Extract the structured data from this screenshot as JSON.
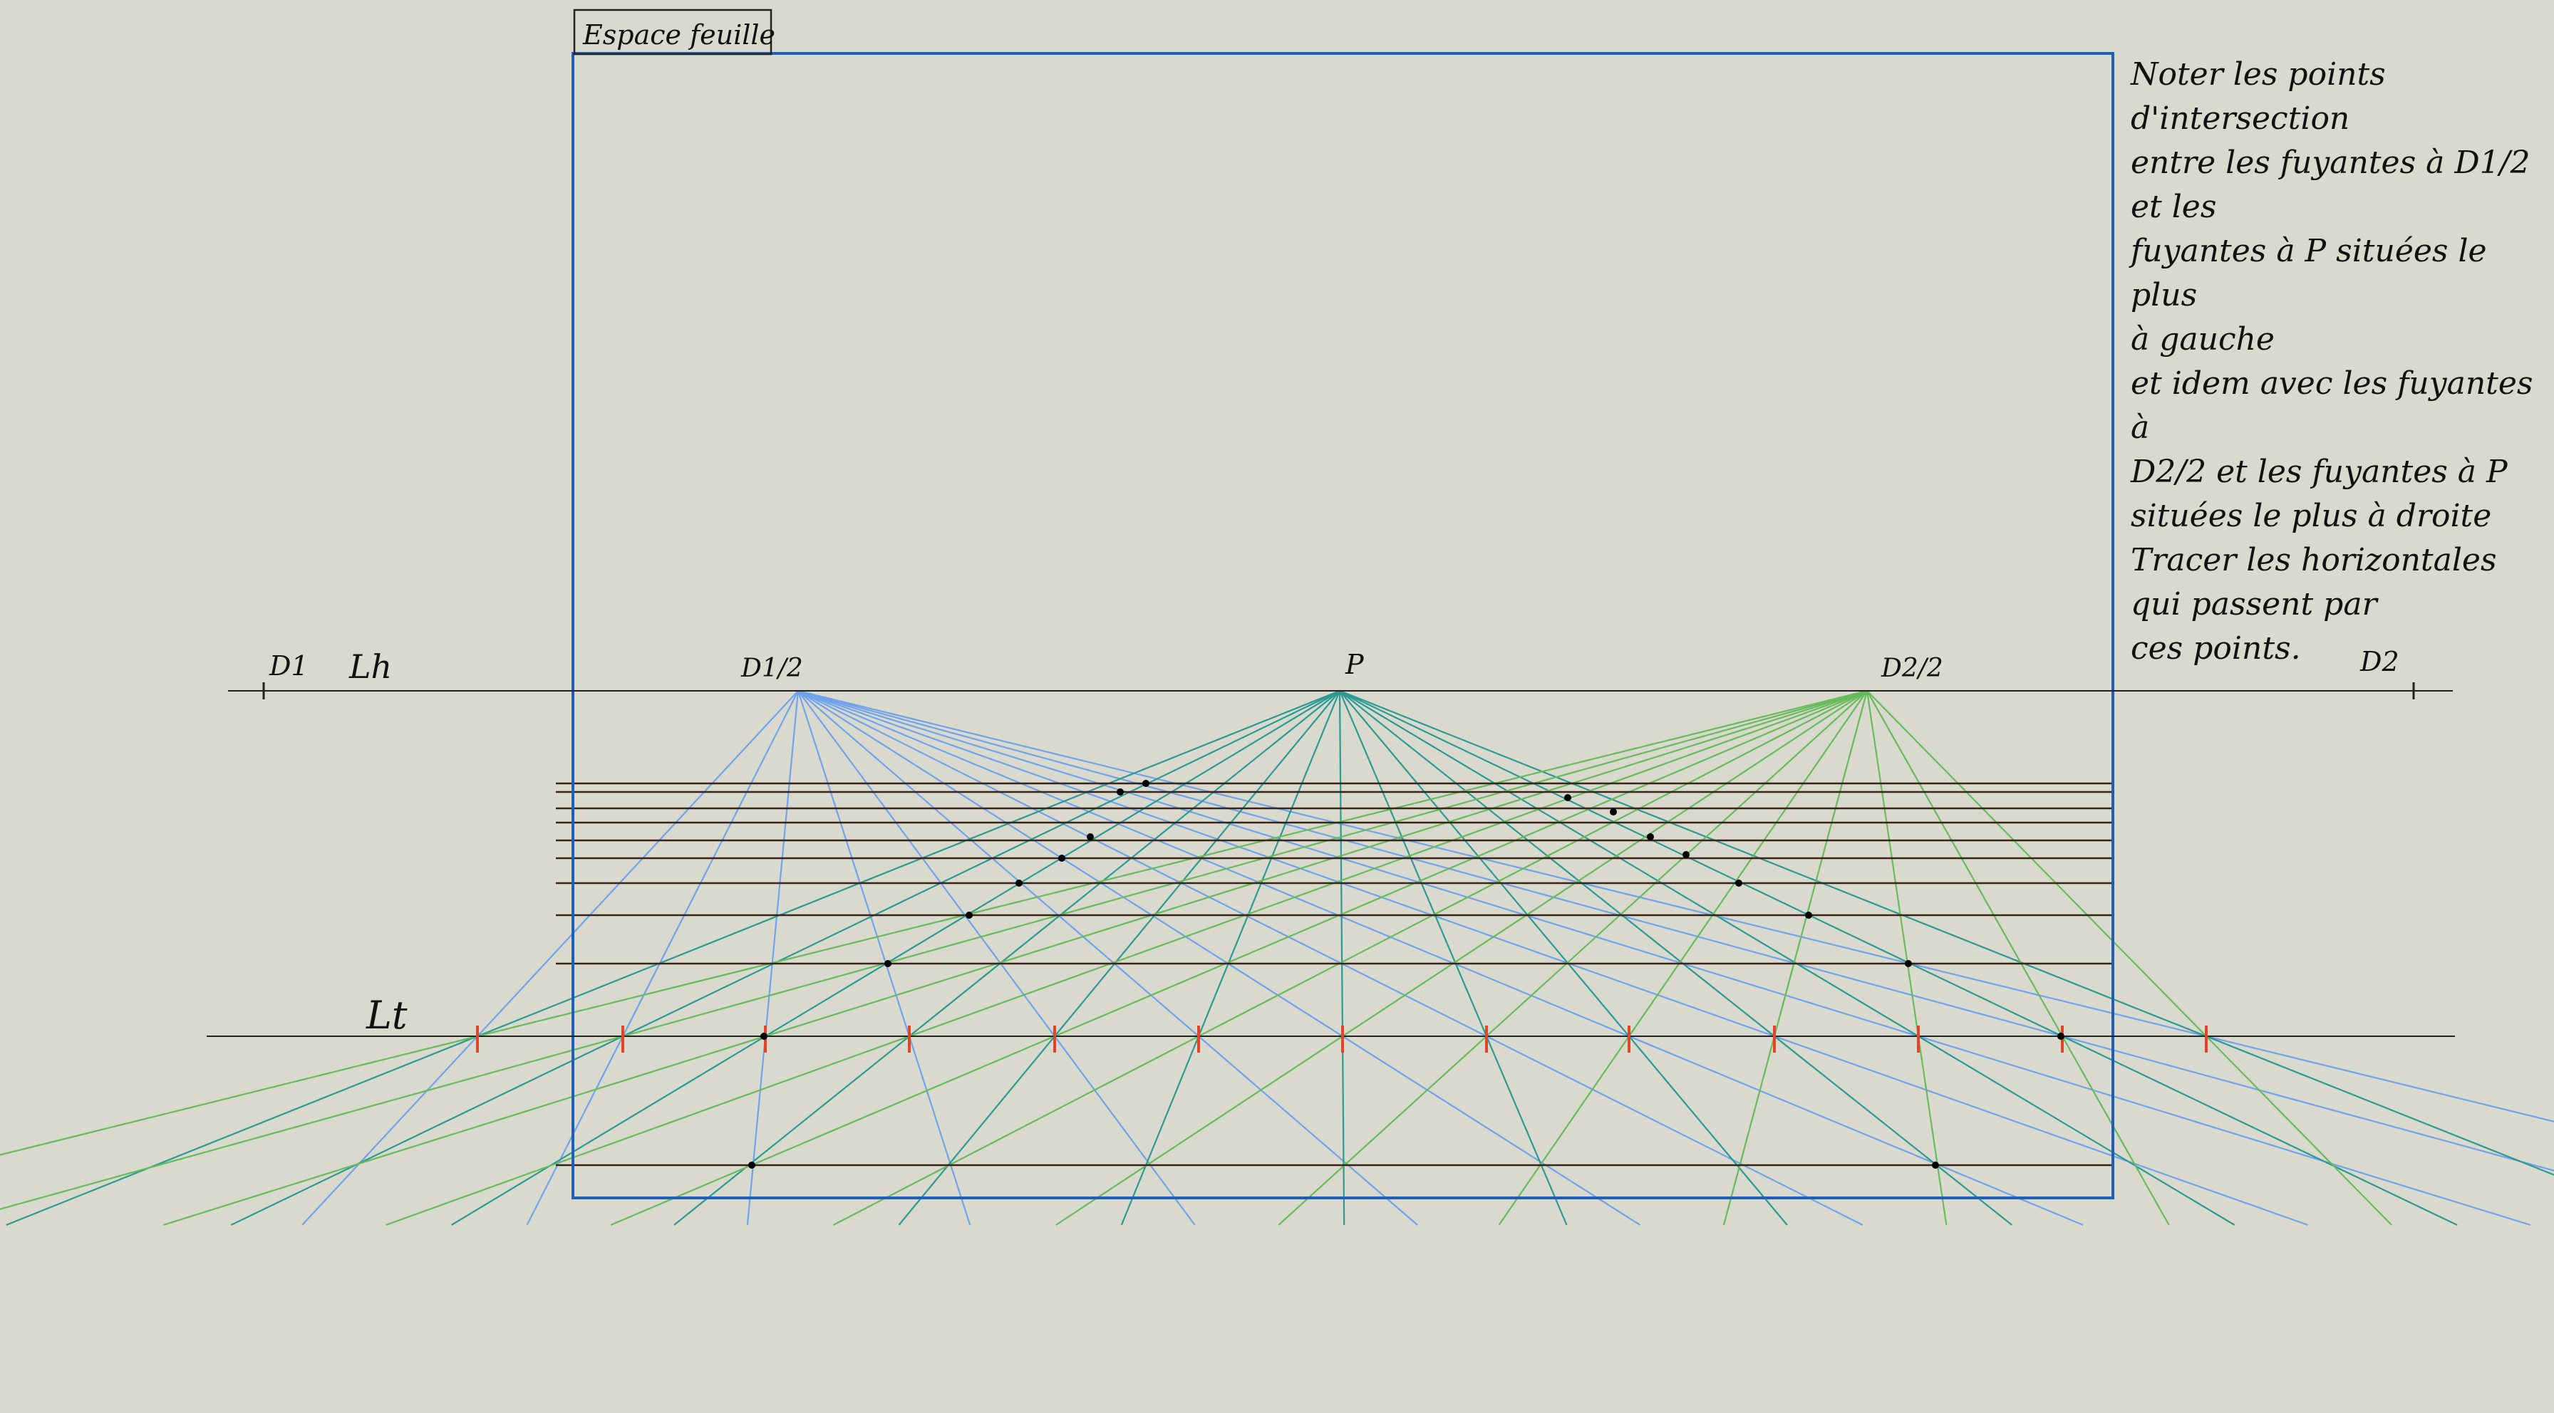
{
  "labels": {
    "espace": "Espace feuille",
    "d1": "D1",
    "lh": "Lh",
    "d12": "D1/2",
    "p": "P",
    "d22": "D2/2",
    "d2": "D2",
    "lt": "Lt"
  },
  "note": "Noter les points d'intersection\nentre les fuyantes à D1/2 et les\nfuyantes à P situées le plus\nà gauche\net idem avec les fuyantes à\nD2/2 et les fuyantes à P\nsituées le plus à droite\nTracer les horizontales\nqui passent par\nces points.",
  "colors": {
    "background": "#dad9cd",
    "frame": "#1f5fb5",
    "lines_to_d12": "#6fa3ec",
    "lines_to_p": "#2a9a92",
    "lines_to_d22": "#66bb5c",
    "horizontals": "#3a2418",
    "ticks": "#e0452a",
    "points": "#000000"
  }
}
